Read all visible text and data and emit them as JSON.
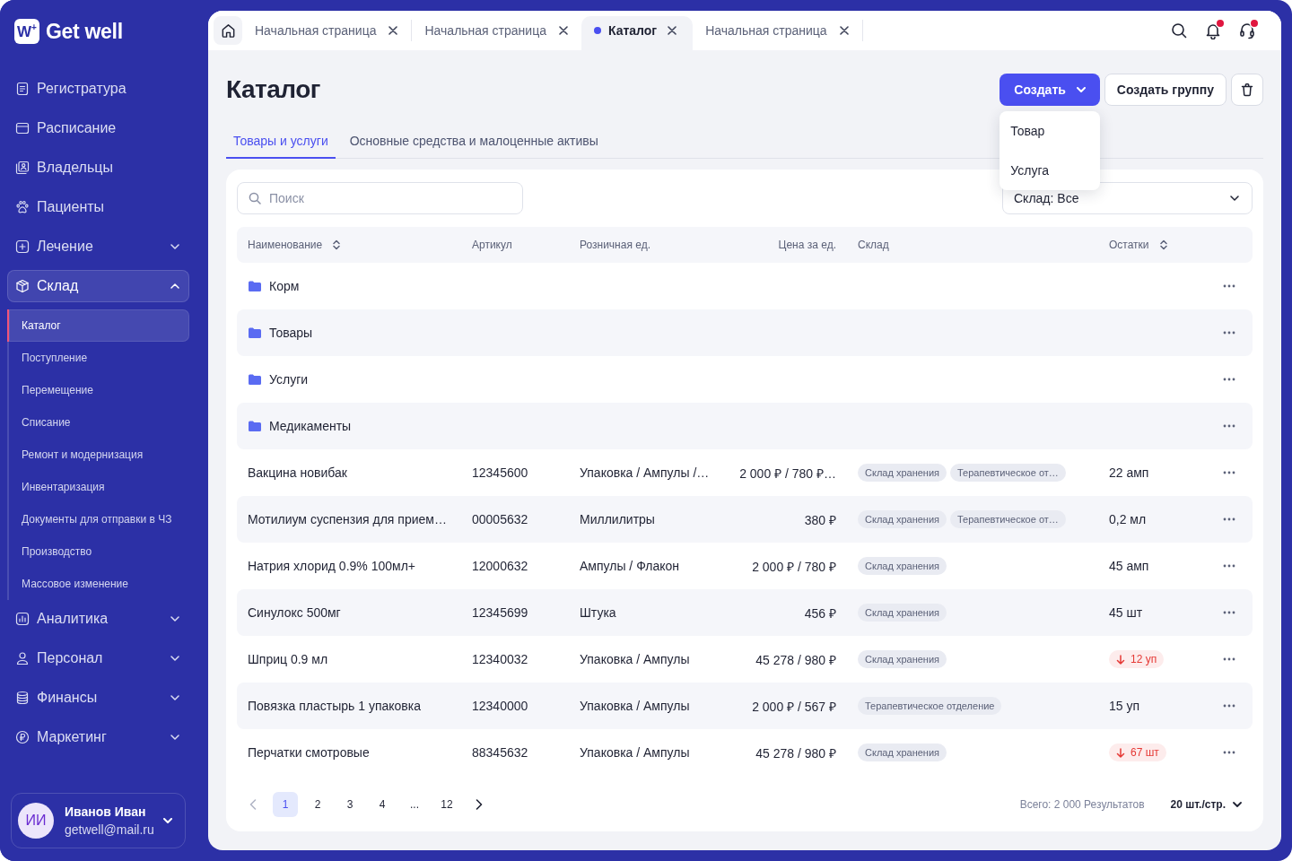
{
  "sidebar": {
    "logo": {
      "mark": "W$^{+}$",
      "name": "Get well"
    },
    "nav": [
      {
        "kind": "link",
        "label": "Регистратура",
        "selected": false
      },
      {
        "kind": "link",
        "label": "Расписание",
        "selected": false
      },
      {
        "kind": "link",
        "label": "Владельцы",
        "selected": false
      },
      {
        "kind": "link",
        "label": "Пациенты",
        "selected": false
      },
      {
        "kind": "group",
        "label": "Лечение",
        "selected": false,
        "expanded": false
      },
      {
        "kind": "group",
        "label": "Склад",
        "selected": true,
        "expanded": true,
        "children": [
          {
            "label": "Каталог",
            "selected": true
          },
          {
            "label": "Поступление",
            "selected": false
          },
          {
            "label": "Перемещение",
            "selected": false
          },
          {
            "label": "Списание",
            "selected": false
          },
          {
            "label": "Ремонт и модернизация",
            "selected": false
          },
          {
            "label": "Инвентаризация",
            "selected": false
          },
          {
            "label": "Документы для отправки в ЧЗ",
            "selected": false
          },
          {
            "label": "Производство",
            "selected": false
          },
          {
            "label": "Массовое изменение",
            "selected": false
          }
        ]
      },
      {
        "kind": "group",
        "label": "Аналитика",
        "selected": false,
        "expanded": false
      },
      {
        "kind": "group",
        "label": "Персонал",
        "selected": false,
        "expanded": false
      },
      {
        "kind": "group",
        "label": "Финансы",
        "selected": false,
        "expanded": false
      },
      {
        "kind": "group",
        "label": "Маркетинг",
        "selected": false,
        "expanded": false
      }
    ],
    "user": {
      "initials": "ИИ",
      "name": "Иванов Иван",
      "email": "getwell@mail.ru"
    }
  },
  "topbar": {
    "tabs": [
      {
        "label": "Начальная страница",
        "selected": false
      },
      {
        "label": "Начальная страница",
        "selected": false
      },
      {
        "label": "Каталог",
        "selected": true
      },
      {
        "label": "Начальная страница",
        "selected": false
      }
    ],
    "actions": [
      {
        "badge": false
      },
      {
        "badge": true
      },
      {
        "badge": true
      }
    ]
  },
  "page": {
    "title": "Каталог",
    "create_button": {
      "label": "Создать",
      "menu_open": true,
      "menu": [
        "Товар",
        "Услуга"
      ]
    },
    "group_button": {
      "label": "Создать группу"
    },
    "tabs": [
      {
        "label": "Товары и услуги",
        "selected": true
      },
      {
        "label": "Основные средства и малоценные активы",
        "selected": false
      }
    ],
    "search": {
      "placeholder": "Поиск"
    },
    "warehouse_filter": {
      "value": "Склад: Все"
    },
    "table": {
      "columns": [
        {
          "label": "Наименование",
          "sortable": true
        },
        {
          "label": "Артикул",
          "sortable": false
        },
        {
          "label": "Розничная ед.",
          "sortable": false
        },
        {
          "label": "Цена за ед.",
          "sortable": false
        },
        {
          "label": "Склад",
          "sortable": false
        },
        {
          "label": "Остатки",
          "sortable": true
        }
      ],
      "rows": [
        {
          "kind": "folder",
          "name": "Корм"
        },
        {
          "kind": "folder",
          "name": "Товары"
        },
        {
          "kind": "folder",
          "name": "Услуги"
        },
        {
          "kind": "folder",
          "name": "Медикаменты"
        },
        {
          "kind": "item",
          "name": "Вакцина новибак",
          "sku": "12345600",
          "unit": "Упаковка / Ампулы /…",
          "price": "2 000 ₽ / 780 ₽…",
          "warehouses": [
            "Склад хранения",
            "Терапевтическое от…"
          ],
          "stock": {
            "text": "22 амп",
            "low": false
          }
        },
        {
          "kind": "item",
          "name": "Мотилиум суспензия для прием…",
          "sku": "00005632",
          "unit": "Миллилитры",
          "price": "380 ₽",
          "warehouses": [
            "Склад хранения",
            "Терапевтическое от…"
          ],
          "stock": {
            "text": "0,2 мл",
            "low": false
          }
        },
        {
          "kind": "item",
          "name": "Натрия хлорид 0.9% 100мл+",
          "sku": "12000632",
          "unit": "Ампулы / Флакон",
          "price": "2 000 ₽ / 780 ₽",
          "warehouses": [
            "Склад хранения"
          ],
          "stock": {
            "text": "45 амп",
            "low": false
          }
        },
        {
          "kind": "item",
          "name": "Синулокс 500мг",
          "sku": "12345699",
          "unit": "Штука",
          "price": "456 ₽",
          "warehouses": [
            "Склад хранения"
          ],
          "stock": {
            "text": "45 шт",
            "low": false
          }
        },
        {
          "kind": "item",
          "name": "Шприц 0.9 мл",
          "sku": "12340032",
          "unit": "Упаковка / Ампулы",
          "price": "45 278 / 980 ₽",
          "warehouses": [
            "Склад хранения"
          ],
          "stock": {
            "text": "12 уп",
            "low": true
          }
        },
        {
          "kind": "item",
          "name": "Повязка пластырь 1 упаковка",
          "sku": "12340000",
          "unit": "Упаковка / Ампулы",
          "price": "2 000 ₽ / 567 ₽",
          "warehouses": [
            "Терапевтическое отделение"
          ],
          "stock": {
            "text": "15 уп",
            "low": false
          }
        },
        {
          "kind": "item",
          "name": "Перчатки смотровые",
          "sku": "88345632",
          "unit": "Упаковка / Ампулы",
          "price": "45 278 / 980 ₽",
          "warehouses": [
            "Склад хранения"
          ],
          "stock": {
            "text": "67 шт",
            "low": true
          }
        }
      ]
    },
    "pagination": {
      "prev_disabled": true,
      "pages": [
        {
          "label": "1",
          "selected": true
        },
        {
          "label": "2",
          "selected": false
        },
        {
          "label": "3",
          "selected": false
        },
        {
          "label": "4",
          "selected": false
        },
        {
          "label": "...",
          "selected": false
        },
        {
          "label": "12",
          "selected": false
        }
      ],
      "total": "Всего: 2 000 Результатов",
      "page_size": "20 шт./стр."
    }
  }
}
